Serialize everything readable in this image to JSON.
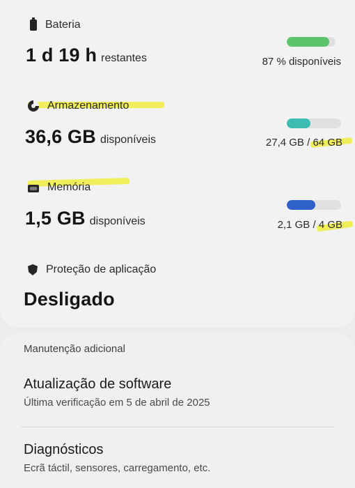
{
  "battery": {
    "label": "Bateria",
    "value": "1 d 19 h",
    "unit": "restantes",
    "status": "87 % disponíveis",
    "level": 0.87,
    "color": "#5cc46a"
  },
  "storage": {
    "label": "Armazenamento",
    "value": "36,6 GB",
    "unit": "disponíveis",
    "used": "27,4 GB",
    "total": "64 GB",
    "level": 0.43,
    "color": "#3dbdb1"
  },
  "memory": {
    "label": "Memória",
    "value": "1,5 GB",
    "unit": "disponíveis",
    "used": "2,1 GB",
    "total": "4 GB",
    "level": 0.53,
    "color": "#2f62c9"
  },
  "app_protection": {
    "label": "Proteção de aplicação",
    "value": "Desligado"
  },
  "additional": {
    "header": "Manutenção adicional",
    "items": [
      {
        "title": "Atualização de software",
        "subtitle": "Última verificação em 5 de abril de 2025"
      },
      {
        "title": "Diagnósticos",
        "subtitle": "Ecrã táctil, sensores, carregamento, etc."
      }
    ]
  },
  "colors": {
    "highlight": "#f0ee4a",
    "background": "#ececec"
  }
}
